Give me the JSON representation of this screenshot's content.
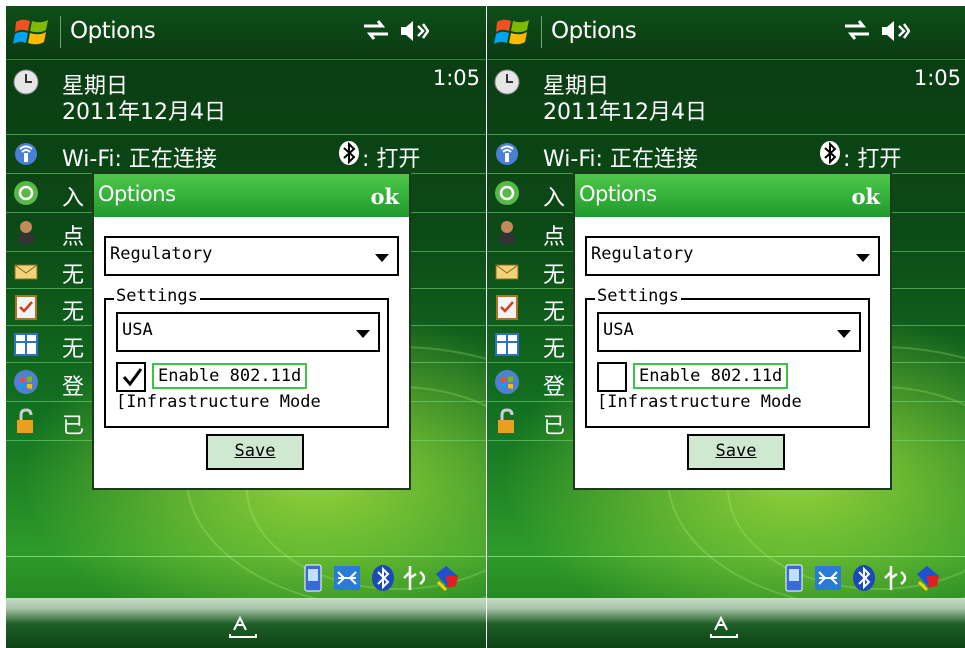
{
  "screens": [
    {
      "id": "left",
      "title": "Options",
      "today": {
        "weekday": "星期日",
        "date": "2011年12月4日",
        "time": "1:05",
        "wifi": "Wi-Fi: 正在连接",
        "bluetooth": ": 打开",
        "items": [
          "入",
          "点",
          "无",
          "无",
          "无",
          "登",
          "已"
        ]
      },
      "dialog": {
        "title": "Options",
        "ok": "ok",
        "category": "Regulatory",
        "group_label": "Settings",
        "country": "USA",
        "enable_label": "Enable 802.11d",
        "enable_checked": true,
        "infra_label": "[Infrastructure Mode",
        "save_label": "Save"
      }
    },
    {
      "id": "right",
      "title": "Options",
      "today": {
        "weekday": "星期日",
        "date": "2011年12月4日",
        "time": "1:05",
        "wifi": "Wi-Fi: 正在连接",
        "bluetooth": ": 打开",
        "items": [
          "入",
          "点",
          "无",
          "无",
          "无",
          "登",
          "已"
        ]
      },
      "dialog": {
        "title": "Options",
        "ok": "ok",
        "category": "Regulatory",
        "group_label": "Settings",
        "country": "USA",
        "enable_label": "Enable 802.11d",
        "enable_checked": false,
        "infra_label": "[Infrastructure Mode",
        "save_label": "Save"
      }
    }
  ],
  "icons": {
    "title_left": "windows-start-icon",
    "title_right": [
      "connectivity-icon",
      "volume-icon"
    ],
    "rows": [
      "clock-icon",
      "wifi-icon",
      "sync-icon",
      "contact-icon",
      "message-icon",
      "task-icon",
      "calendar-icon",
      "windows-live-icon",
      "lock-icon"
    ],
    "tray": [
      "device-icon",
      "network-icon",
      "bluetooth-icon",
      "usb-icon",
      "security-icon"
    ],
    "softbar": "keyboard-icon"
  },
  "colors": {
    "titlebar": "#0a3a12",
    "dialog_header": "#2aa534",
    "save_button": "#cfe8cf",
    "focus_border": "#3fc24a"
  }
}
